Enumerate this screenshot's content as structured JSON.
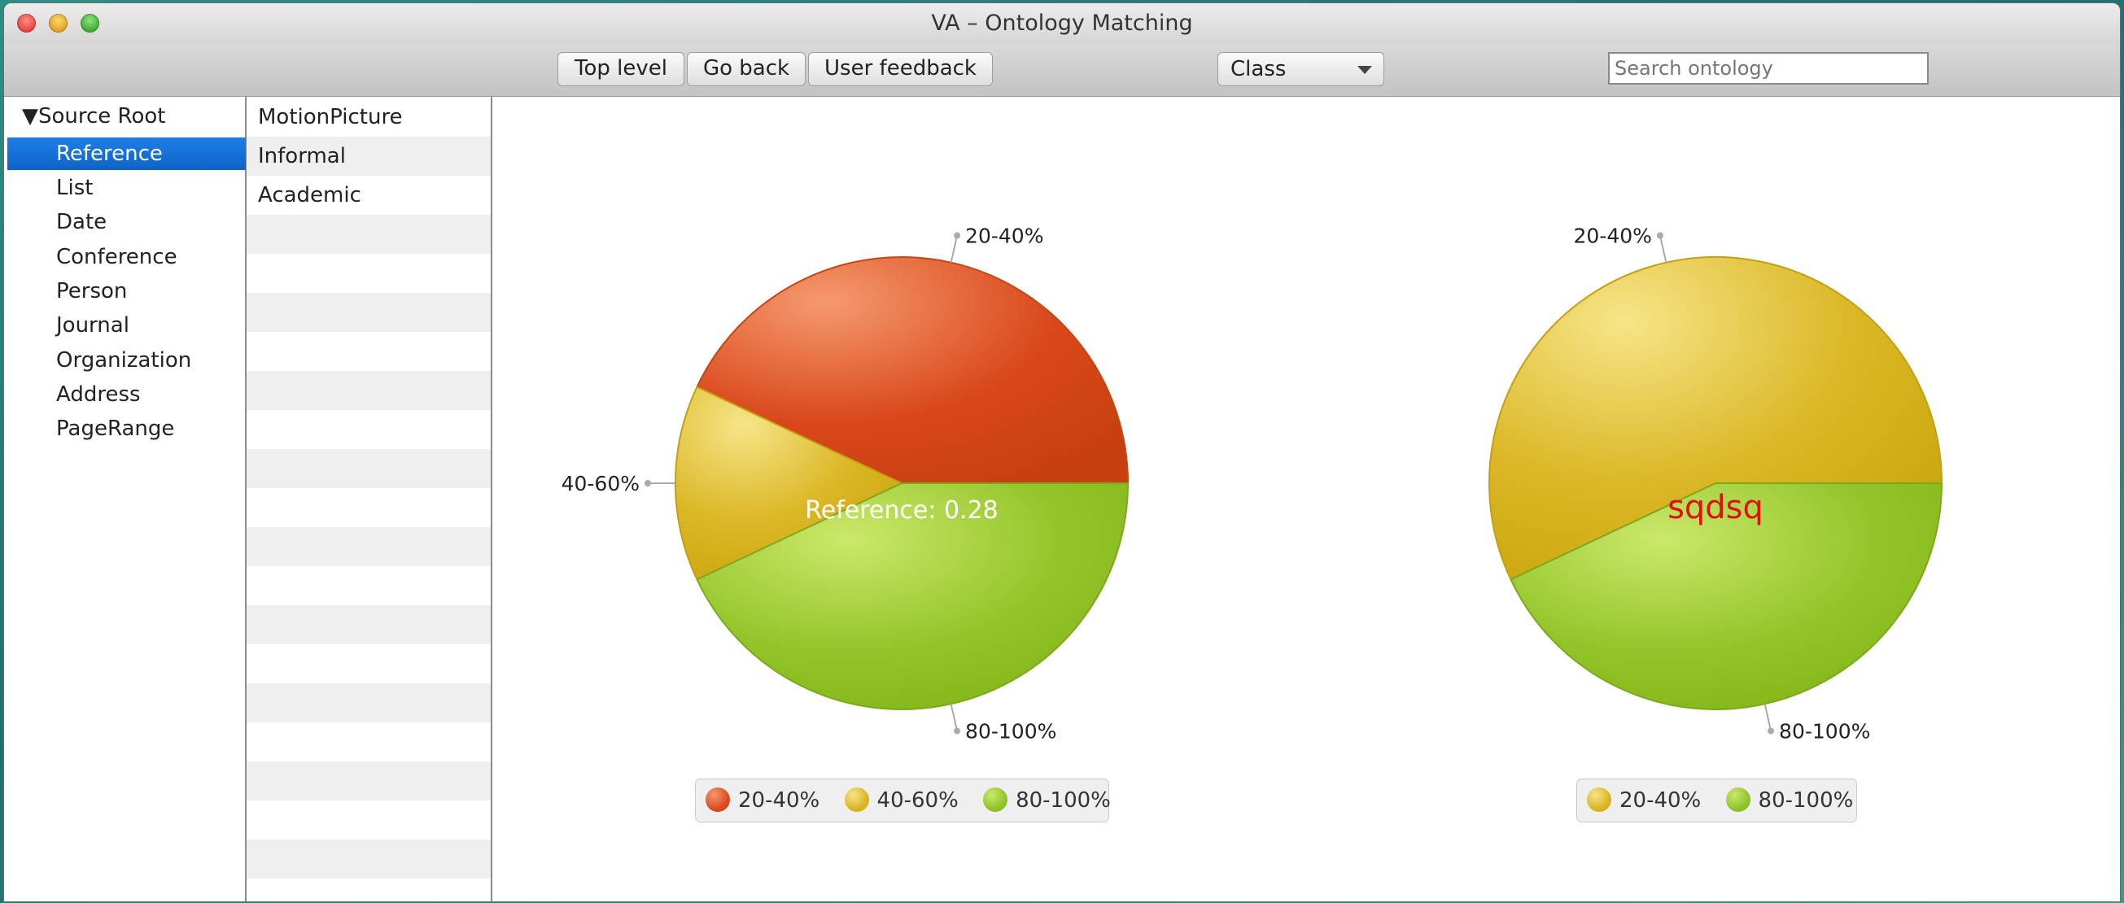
{
  "window": {
    "title": "VA – Ontology Matching"
  },
  "toolbar": {
    "top_level_label": "Top level",
    "go_back_label": "Go back",
    "user_feedback_label": "User feedback",
    "type_select_value": "Class",
    "search_placeholder": "Search ontology"
  },
  "tree": {
    "root_label": "▼Source Root",
    "items": [
      {
        "label": "Reference",
        "selected": true
      },
      {
        "label": "List"
      },
      {
        "label": "Date"
      },
      {
        "label": "Conference"
      },
      {
        "label": "Person"
      },
      {
        "label": "Journal"
      },
      {
        "label": "Organization"
      },
      {
        "label": "Address"
      },
      {
        "label": "PageRange"
      }
    ]
  },
  "list": {
    "items": [
      "MotionPicture",
      "Informal",
      "Academic"
    ]
  },
  "colors": {
    "red": "#d9471a",
    "yellow": "#d8b21e",
    "green": "#8cc12a",
    "selection": "#1b78de",
    "center_label_red": "#e01010"
  },
  "chart_data": [
    {
      "type": "pie",
      "center_label": "Reference: 0.28",
      "slices": [
        {
          "label": "20-40%",
          "value": 43,
          "color": "#d9471a"
        },
        {
          "label": "40-60%",
          "value": 14,
          "color": "#d8b21e"
        },
        {
          "label": "80-100%",
          "value": 43,
          "color": "#8cc12a"
        }
      ],
      "legend": [
        "20-40%",
        "40-60%",
        "80-100%"
      ],
      "legend_position": "bottom"
    },
    {
      "type": "pie",
      "center_label": "sqdsq",
      "slices": [
        {
          "label": "20-40%",
          "value": 57,
          "color": "#d8b21e"
        },
        {
          "label": "80-100%",
          "value": 43,
          "color": "#8cc12a"
        }
      ],
      "legend": [
        "20-40%",
        "80-100%"
      ],
      "legend_position": "bottom"
    }
  ]
}
